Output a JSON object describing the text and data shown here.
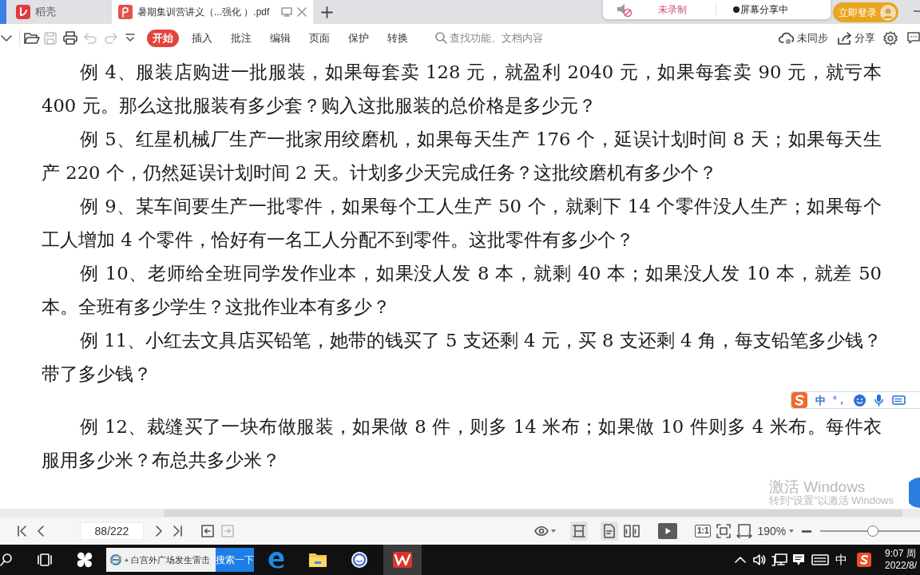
{
  "tabs": [
    {
      "kind": "home",
      "label": "稻壳",
      "selected": false
    },
    {
      "kind": "document",
      "label": "暑期集训营讲义（...强化 ）.pdf",
      "selected": true
    }
  ],
  "recorder": {
    "status": "未录制",
    "sharing": "屏幕分享中",
    "login": "立即登录"
  },
  "toolbar": {
    "quick_tools": [
      {
        "kind": "open",
        "disabled": false
      },
      {
        "kind": "save",
        "disabled": true
      },
      {
        "kind": "print",
        "disabled": false
      },
      {
        "kind": "undo",
        "disabled": true
      },
      {
        "kind": "redo",
        "disabled": true
      }
    ],
    "menu": [
      {
        "label": "开始",
        "selected": true
      },
      {
        "label": "插入",
        "selected": false
      },
      {
        "label": "批注",
        "selected": false
      },
      {
        "label": "编辑",
        "selected": false
      },
      {
        "label": "页面",
        "selected": false
      },
      {
        "label": "保护",
        "selected": false
      },
      {
        "label": "转换",
        "selected": false
      }
    ],
    "search": {
      "placeholder": "查找功能、文档内容"
    },
    "sync": "未同步",
    "share": "分享"
  },
  "document": {
    "paragraphs": [
      "例 4、服装店购进一批服装，如果每套卖 128 元，就盈利 2040 元，如果每套卖 90 元，就亏本 400 元。那么这批服装有多少套？购入这批服装的总价格是多少元？",
      "例 5、红星机械厂生产一批家用绞磨机，如果每天生产 176 个，延误计划时间 8 天；如果每天生产 220 个，仍然延误计划时间 2 天。计划多少天完成任务？这批绞磨机有多少个？",
      "例 9、某车间要生产一批零件，如果每个工人生产 50 个，就剩下 14 个零件没人生产；如果每个工人增加 4 个零件，恰好有一名工人分配不到零件。这批零件有多少个？",
      "例 10、老师给全班同学发作业本，如果没人发 8 本，就剩 40 本；如果没人发 10 本，就差 50 本。全班有多少学生？这批作业本有多少？",
      "例 11、小红去文具店买铅笔，她带的钱买了 5 支还剩 4 元，买 8 支还剩 4 角，每支铅笔多少钱？带了多少钱？",
      "例 12、裁缝买了一块布做服装，如果做 8 件，则多 14 米布；如果做 10 件则多 4 米布。每件衣服用多少米？布总共多少米？"
    ]
  },
  "ime_bar": {
    "mode": "中",
    "punctuation": "°，"
  },
  "activation_notice": {
    "title": "激活 Windows",
    "hint": "转到“设置”以激活 Windows"
  },
  "status_bar": {
    "history": [
      {
        "kind": "back",
        "disabled": false
      },
      {
        "kind": "forward",
        "disabled": true
      }
    ],
    "page": {
      "value": "88/222"
    },
    "view_modes": [
      {
        "kind": "fit-width",
        "selected": true
      },
      {
        "kind": "single-page",
        "selected": true
      },
      {
        "kind": "two-page",
        "selected": false
      }
    ],
    "actual_size": "1:1",
    "zoom": {
      "reading": "190%",
      "level": 0.53
    }
  },
  "taskbar": {
    "search_box": {
      "value": "白宫外广场发生雷击",
      "button": "搜索一下"
    },
    "apps": [
      {
        "kind": "edge",
        "active": false
      },
      {
        "kind": "explorer",
        "active": false
      },
      {
        "kind": "circle",
        "active": false
      },
      {
        "kind": "wps",
        "active": true
      }
    ],
    "tray": {
      "input_mode": "中",
      "time": "9:07 周",
      "date": "2022/8/"
    }
  }
}
